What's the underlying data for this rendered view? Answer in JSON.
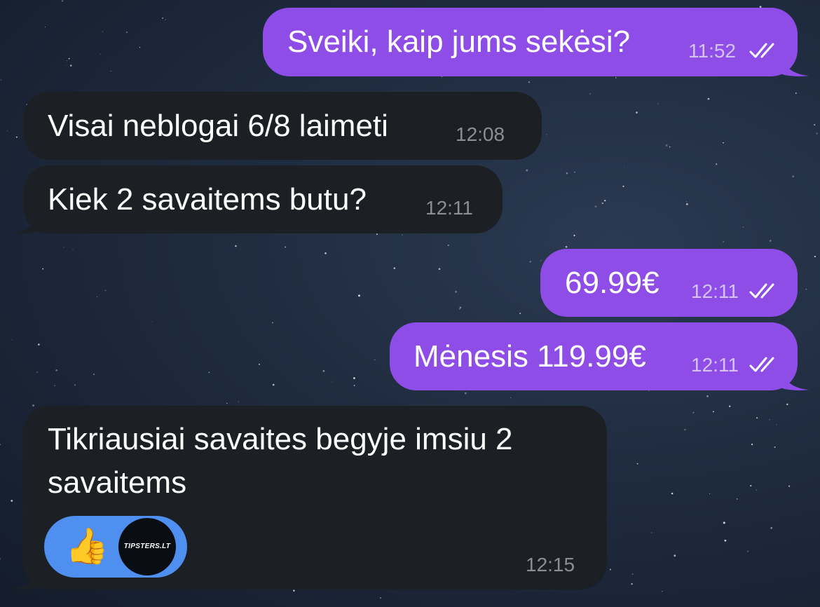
{
  "messages": [
    {
      "id": "m1",
      "direction": "outgoing",
      "text": "Sveiki, kaip jums sekėsi?",
      "time": "11:52",
      "read": true
    },
    {
      "id": "m2",
      "direction": "incoming",
      "text": "Visai neblogai 6/8 laimeti",
      "time": "12:08"
    },
    {
      "id": "m3",
      "direction": "incoming",
      "text": "Kiek 2 savaitems butu?",
      "time": "12:11"
    },
    {
      "id": "m4",
      "direction": "outgoing",
      "text": "69.99€",
      "time": "12:11",
      "read": true
    },
    {
      "id": "m5",
      "direction": "outgoing",
      "text": "Mėnesis 119.99€",
      "time": "12:11",
      "read": true
    },
    {
      "id": "m6",
      "direction": "incoming",
      "text_line1": "Tikriausiai savaites begyje imsiu 2",
      "text_line2": "savaitems",
      "time": "12:15",
      "reaction": {
        "emoji": "👍",
        "avatar_text": "TIPSTERS.LT"
      }
    }
  ],
  "colors": {
    "outgoing_bubble": "#8e4de6",
    "incoming_bubble": "#1c1f24",
    "reaction_pill": "#4f8ff0"
  },
  "icons": {
    "read_ticks": "double-check-icon",
    "reaction": "thumbs-up-icon"
  }
}
